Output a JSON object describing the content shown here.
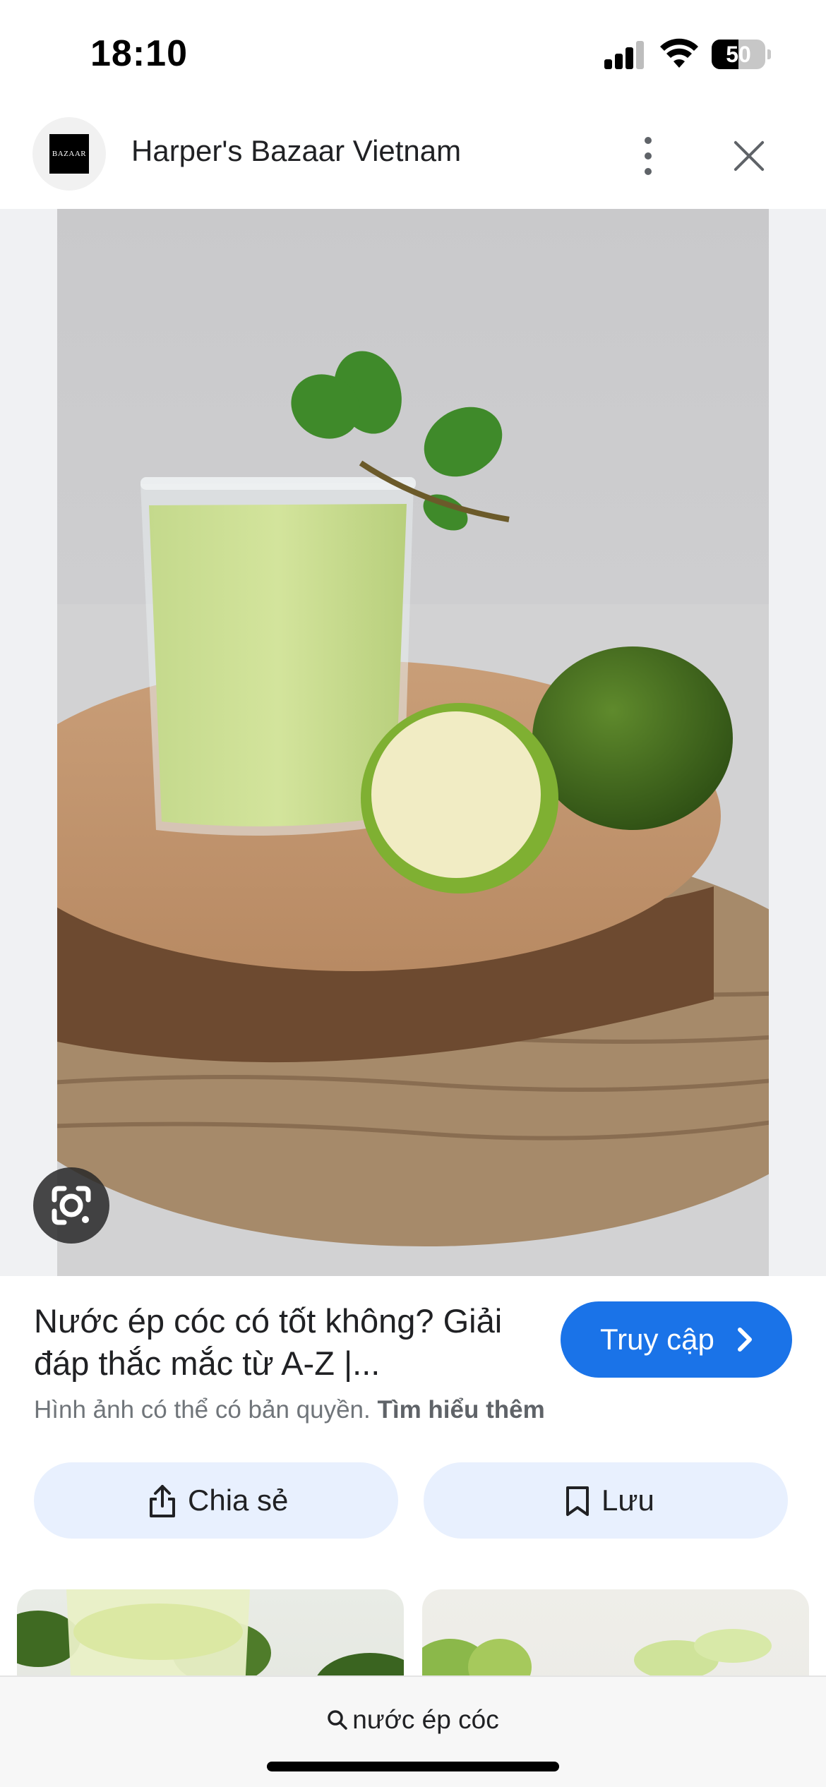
{
  "status_bar": {
    "time": "18:10",
    "battery_level": "50",
    "battery_fraction": 0.5
  },
  "header": {
    "logo_text": "BAZAAR",
    "site_name": "Harper's Bazaar Vietnam"
  },
  "result": {
    "title": "Nước ép cóc có tốt không? Giải đáp thắc mắc từ A-Z |...",
    "visit_label": "Truy cập",
    "copyright_text": "Hình ảnh có thể có bản quyền.",
    "learn_more": "Tìm hiểu thêm",
    "share_label": "Chia sẻ",
    "save_label": "Lưu"
  },
  "bottom_bar": {
    "query": "nước ép cóc"
  },
  "colors": {
    "accent": "#1a73e8",
    "action_bg": "#e8f0fe"
  }
}
